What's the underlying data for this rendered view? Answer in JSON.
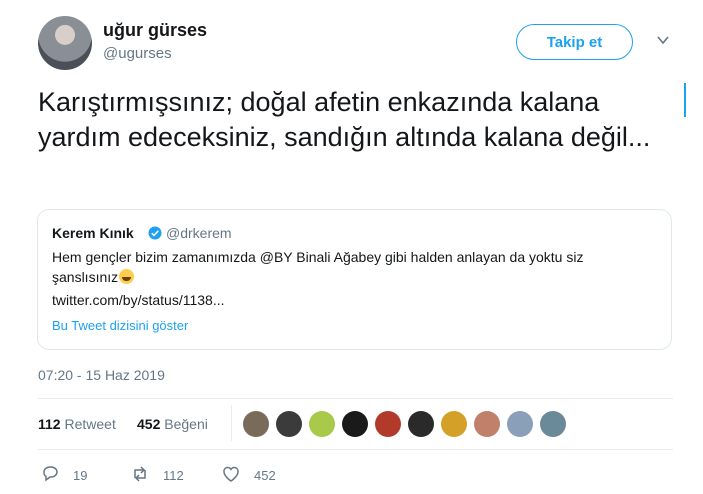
{
  "author": {
    "name": "uğur gürses",
    "handle": "@ugurses",
    "avatar": "avatar-icon"
  },
  "follow_label": "Takip et",
  "tweet_text": "Karıştırmışsınız; doğal afetin enkazında kalana yardım edeceksiniz, sandığın altında kalana değil...",
  "quoted": {
    "name": "Kerem Kınık",
    "handle": "@drkerem",
    "text": "Hem gençler bizim zamanımızda @BY Binali Ağabey gibi halden anlayan da yoktu siz şanslısınız",
    "emoji": "grinning-face-icon",
    "link": "twitter.com/by/status/1138...",
    "thread_label": "Bu Tweet dizisini göster"
  },
  "timestamp": "07:20 - 15 Haz 2019",
  "stats": {
    "retweets": "112",
    "retweets_label": "Retweet",
    "likes": "452",
    "likes_label": "Beğeni"
  },
  "likers": [
    "#7a6a5a",
    "#3b3b3b",
    "#a8c94a",
    "#1a1a1a",
    "#b23a2a",
    "#2a2a2a",
    "#d4a028",
    "#c0806a",
    "#8aa0b8",
    "#6a8a9a"
  ],
  "actions": {
    "replies": "19",
    "retweets": "112",
    "likes": "452"
  },
  "colors": {
    "accent": "#1da1f2",
    "text": "#14171a",
    "muted": "#657786",
    "border": "#e1e8ed"
  }
}
